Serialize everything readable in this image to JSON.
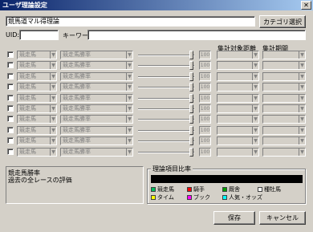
{
  "window": {
    "title": "ユーザ理論設定",
    "close": "✕"
  },
  "top": {
    "name_value": "競馬道マル得理論",
    "category_button": "カテゴリ選択",
    "uid_label": "UID:",
    "uid_value": "",
    "keyword_label": "キーワード:",
    "keyword_value": ""
  },
  "columns": {
    "distance": "集計対象距離",
    "period": "集計期間"
  },
  "rows": [
    {
      "sel1": "競走馬",
      "sel2": "競走馬勝率",
      "value": "100"
    },
    {
      "sel1": "競走馬",
      "sel2": "競走馬勝率",
      "value": "100"
    },
    {
      "sel1": "競走馬",
      "sel2": "競走馬勝率",
      "value": "100"
    },
    {
      "sel1": "競走馬",
      "sel2": "競走馬勝率",
      "value": "100"
    },
    {
      "sel1": "競走馬",
      "sel2": "競走馬勝率",
      "value": "100"
    },
    {
      "sel1": "競走馬",
      "sel2": "競走馬勝率",
      "value": "100"
    },
    {
      "sel1": "競走馬",
      "sel2": "競走馬勝率",
      "value": "100"
    },
    {
      "sel1": "競走馬",
      "sel2": "競走馬勝率",
      "value": "100"
    },
    {
      "sel1": "競走馬",
      "sel2": "競走馬勝率",
      "value": "100"
    },
    {
      "sel1": "競走馬",
      "sel2": "競走馬勝率",
      "value": "100"
    }
  ],
  "description": {
    "line1": "競走馬勝率",
    "line2": "過去の全レースの評価"
  },
  "ratio": {
    "title": "理論項目比率",
    "legend": [
      {
        "label": "競走馬",
        "color": "#00c060"
      },
      {
        "label": "騎手",
        "color": "#ff0000"
      },
      {
        "label": "厩舎",
        "color": "#00a000"
      },
      {
        "label": "種牡馬",
        "color": "#ffffff"
      },
      {
        "label": "タイム",
        "color": "#ffff00"
      },
      {
        "label": "ブック",
        "color": "#ff00ff"
      },
      {
        "label": "人気・オッズ",
        "color": "#00ffff"
      }
    ]
  },
  "buttons": {
    "save": "保存",
    "cancel": "キャンセル"
  }
}
